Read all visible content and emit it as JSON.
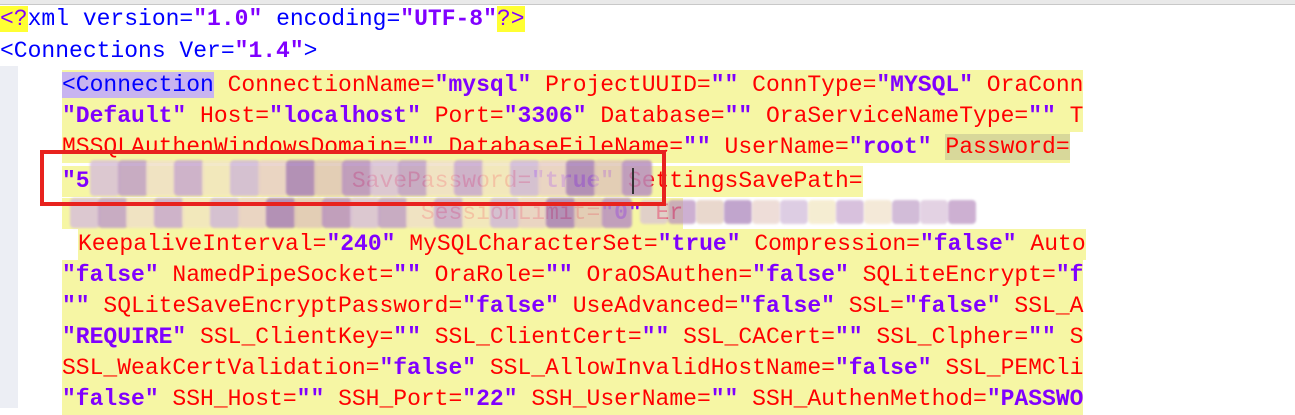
{
  "editor": {
    "lines": [
      {
        "seg": [
          {
            "t": "<?",
            "c": "pi"
          },
          {
            "t": "xml version=",
            "c": "kw"
          },
          {
            "t": "\"1.0\"",
            "c": "val"
          },
          {
            "t": " encoding=",
            "c": "kw"
          },
          {
            "t": "\"UTF-8\"",
            "c": "val"
          },
          {
            "t": "?>",
            "c": "pi"
          }
        ]
      },
      {
        "seg": [
          {
            "t": "<Connections Ver=",
            "c": "tag"
          },
          {
            "t": "\"1.4\"",
            "c": "val"
          },
          {
            "t": ">",
            "c": "tag"
          }
        ]
      },
      {
        "seg": [
          {
            "t": "<Connection",
            "c": "selTag"
          },
          {
            "t": " ConnectionName=",
            "c": "at"
          },
          {
            "t": "\"mysql\"",
            "c": "val"
          },
          {
            "t": " ProjectUUID=",
            "c": "at"
          },
          {
            "t": "\"\"",
            "c": "val"
          },
          {
            "t": " ConnType=",
            "c": "at"
          },
          {
            "t": "\"MYSQL\"",
            "c": "val"
          },
          {
            "t": " OraConn",
            "c": "at"
          }
        ]
      },
      {
        "seg": [
          {
            "t": "\"Default\"",
            "c": "val"
          },
          {
            "t": " Host=",
            "c": "at"
          },
          {
            "t": "\"localhost\"",
            "c": "val"
          },
          {
            "t": " Port=",
            "c": "at"
          },
          {
            "t": "\"3306\"",
            "c": "val"
          },
          {
            "t": " Database=",
            "c": "at"
          },
          {
            "t": "\"\"",
            "c": "val"
          },
          {
            "t": " OraServiceNameType=",
            "c": "at"
          },
          {
            "t": "\"\"",
            "c": "val"
          },
          {
            "t": " T",
            "c": "at"
          }
        ]
      },
      {
        "seg": [
          {
            "t": "MSSQLAuthenWindowsDomain=",
            "c": "at"
          },
          {
            "t": "\"\"",
            "c": "val"
          },
          {
            "t": " DatabaseFileName=",
            "c": "at"
          },
          {
            "t": "\"\"",
            "c": "val"
          },
          {
            "t": " UserName=",
            "c": "at"
          },
          {
            "t": "\"root\"",
            "c": "val"
          },
          {
            "t": " ",
            "c": "at"
          },
          {
            "t": "Password=",
            "c": "pwdat"
          }
        ]
      },
      {
        "seg": [
          {
            "t": "\"5",
            "c": "val"
          },
          {
            "t": "                   ",
            "c": "at"
          },
          {
            "t": "SavePassword=",
            "c": "at"
          },
          {
            "t": "\"true\"",
            "c": "val"
          },
          {
            "t": " SettingsSavePath=",
            "c": "at"
          }
        ]
      },
      {
        "seg": [
          {
            "t": "                          ",
            "c": "at"
          },
          {
            "t": "SessionLimit=",
            "c": "at"
          },
          {
            "t": "\"0\"",
            "c": "val"
          },
          {
            "t": " Er",
            "c": "at"
          }
        ]
      },
      {
        "seg": [
          {
            "t": "KeepaliveInterval=",
            "c": "at"
          },
          {
            "t": "\"240\"",
            "c": "val"
          },
          {
            "t": " MySQLCharacterSet=",
            "c": "at"
          },
          {
            "t": "\"true\"",
            "c": "val"
          },
          {
            "t": " Compression=",
            "c": "at"
          },
          {
            "t": "\"false\"",
            "c": "val"
          },
          {
            "t": " Auto",
            "c": "at"
          }
        ]
      },
      {
        "seg": [
          {
            "t": "\"false\"",
            "c": "val"
          },
          {
            "t": " NamedPipeSocket=",
            "c": "at"
          },
          {
            "t": "\"\"",
            "c": "val"
          },
          {
            "t": " OraRole=",
            "c": "at"
          },
          {
            "t": "\"\"",
            "c": "val"
          },
          {
            "t": " OraOSAuthen=",
            "c": "at"
          },
          {
            "t": "\"false\"",
            "c": "val"
          },
          {
            "t": " SQLiteEncrypt=",
            "c": "at"
          },
          {
            "t": "\"f",
            "c": "val"
          }
        ]
      },
      {
        "seg": [
          {
            "t": "\"\"",
            "c": "val"
          },
          {
            "t": " SQLiteSaveEncryptPassword=",
            "c": "at"
          },
          {
            "t": "\"false\"",
            "c": "val"
          },
          {
            "t": " UseAdvanced=",
            "c": "at"
          },
          {
            "t": "\"false\"",
            "c": "val"
          },
          {
            "t": " SSL=",
            "c": "at"
          },
          {
            "t": "\"false\"",
            "c": "val"
          },
          {
            "t": " SSL_A",
            "c": "at"
          }
        ]
      },
      {
        "seg": [
          {
            "t": "\"REQUIRE\"",
            "c": "val"
          },
          {
            "t": " SSL_ClientKey=",
            "c": "at"
          },
          {
            "t": "\"\"",
            "c": "val"
          },
          {
            "t": " SSL_ClientCert=",
            "c": "at"
          },
          {
            "t": "\"\"",
            "c": "val"
          },
          {
            "t": " SSL_CACert=",
            "c": "at"
          },
          {
            "t": "\"\"",
            "c": "val"
          },
          {
            "t": " SSL_Clpher=",
            "c": "at"
          },
          {
            "t": "\"\"",
            "c": "val"
          },
          {
            "t": " S",
            "c": "at"
          }
        ]
      },
      {
        "seg": [
          {
            "t": "SSL_WeakCertValidation=",
            "c": "at"
          },
          {
            "t": "\"false\"",
            "c": "val"
          },
          {
            "t": " SSL_AllowInvalidHostName=",
            "c": "at"
          },
          {
            "t": "\"false\"",
            "c": "val"
          },
          {
            "t": " SSL_PEMCli",
            "c": "at"
          }
        ]
      },
      {
        "seg": [
          {
            "t": "\"false\"",
            "c": "val"
          },
          {
            "t": " SSH_Host=",
            "c": "at"
          },
          {
            "t": "\"\"",
            "c": "val"
          },
          {
            "t": " SSH_Port=",
            "c": "at"
          },
          {
            "t": "\"22\"",
            "c": "val"
          },
          {
            "t": " SSH_UserName=",
            "c": "at"
          },
          {
            "t": "\"\"",
            "c": "val"
          },
          {
            "t": " SSH_AuthenMethod=",
            "c": "at"
          },
          {
            "t": "\"PASSWO",
            "c": "val"
          }
        ]
      }
    ]
  },
  "colors": {
    "highlight": "#f6f6a4",
    "attribute": "#ff0000",
    "value": "#8000ff",
    "tag": "#0000ff",
    "redact_box": "#e8221e"
  }
}
